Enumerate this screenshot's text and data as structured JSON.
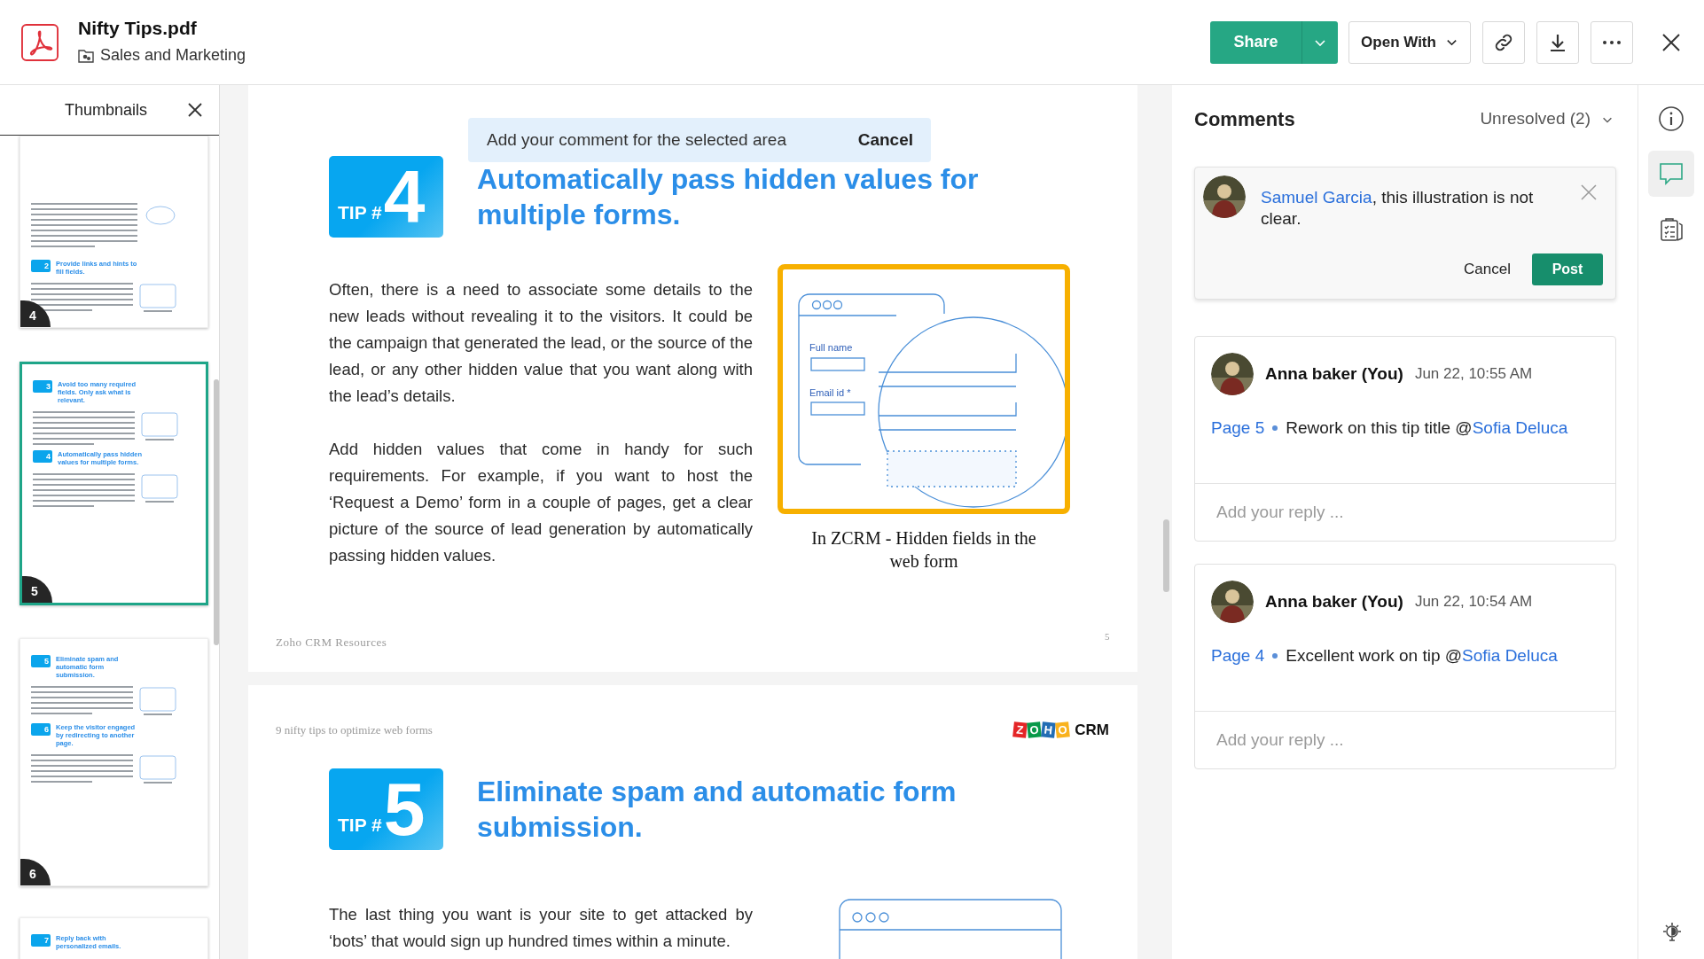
{
  "header": {
    "file_name": "Nifty Tips.pdf",
    "folder": "Sales and Marketing",
    "share": "Share",
    "open_with": "Open With"
  },
  "thumbnails": {
    "title": "Thumbnails",
    "pages": [
      {
        "page": "4",
        "selected": false,
        "tips": [
          {
            "number": "2",
            "title": "Provide links and hints to fill fields."
          }
        ]
      },
      {
        "page": "5",
        "selected": true,
        "tips": [
          {
            "number": "3",
            "title": "Avoid too many required fields. Only ask what is relevant."
          },
          {
            "number": "4",
            "title": "Automatically pass hidden values for multiple forms."
          }
        ]
      },
      {
        "page": "6",
        "selected": false,
        "tips": [
          {
            "number": "5",
            "title": "Eliminate spam and automatic form submission."
          },
          {
            "number": "6",
            "title": "Keep the visitor engaged by redirecting to another page."
          }
        ]
      },
      {
        "selected": false,
        "tips": [
          {
            "number": "7",
            "title": "Reply back with personalized emails."
          }
        ]
      }
    ]
  },
  "document": {
    "comment_prompt": {
      "text": "Add your comment for the selected area",
      "cancel": "Cancel"
    },
    "pages": [
      {
        "kind": "tip_page",
        "tip": {
          "badge": "TIP #",
          "number": "4",
          "title": "Automatically pass hidden values for multiple forms."
        },
        "paragraphs": [
          "Often, there is a need to associate some details to the new leads without revealing it to the visitors. It could be the campaign that generated the lead, or the source of the lead, or any other hidden value that you want along with the lead’s details.",
          "Add hidden values that come in handy for such requirements. For example, if you want to host the ‘Request a Demo’ form in a couple of pages, get a clear picture of the source of lead generation by automatically passing hidden values."
        ],
        "figure": {
          "fields": [
            "Full name",
            "Email id *"
          ],
          "caption": "In ZCRM - Hidden fields in the web form"
        },
        "footer": "Zoho CRM Resources",
        "page_number": "5"
      },
      {
        "kind": "tip_page_start",
        "running_head": "9 nifty tips to optimize web forms",
        "logo": {
          "letters": [
            {
              "char": "Z",
              "color": "#e42527"
            },
            {
              "char": "O",
              "color": "#089949"
            },
            {
              "char": "H",
              "color": "#226db4"
            },
            {
              "char": "O",
              "color": "#f9b21d"
            }
          ],
          "product": "CRM"
        },
        "tip": {
          "badge": "TIP #",
          "number": "5",
          "title": "Eliminate spam and automatic form submission."
        },
        "paragraphs": [
          "The last thing you want is your site to get attacked by ‘bots’ that would sign up hundred times within a minute."
        ]
      }
    ]
  },
  "comments": {
    "title": "Comments",
    "filter": "Unresolved (2)",
    "draft": {
      "mention": "Samuel Garcia",
      "text": ", this illustration is not clear.",
      "cancel": "Cancel",
      "post": "Post"
    },
    "threads": [
      {
        "author": "Anna baker (You)",
        "time": "Jun 22, 10:55 AM",
        "page": "Page 5",
        "text": "Rework on this tip title @",
        "mention": "Sofia Deluca",
        "reply_placeholder": "Add your reply ..."
      },
      {
        "author": "Anna baker (You)",
        "time": "Jun 22, 10:54 AM",
        "page": "Page 4",
        "text": "Excellent work on tip @",
        "mention": "Sofia Deluca",
        "reply_placeholder": "Add your reply ..."
      }
    ]
  },
  "rail": [
    {
      "kind": "info",
      "selected": false
    },
    {
      "kind": "comments",
      "selected": true
    },
    {
      "kind": "tasks",
      "selected": false
    }
  ]
}
